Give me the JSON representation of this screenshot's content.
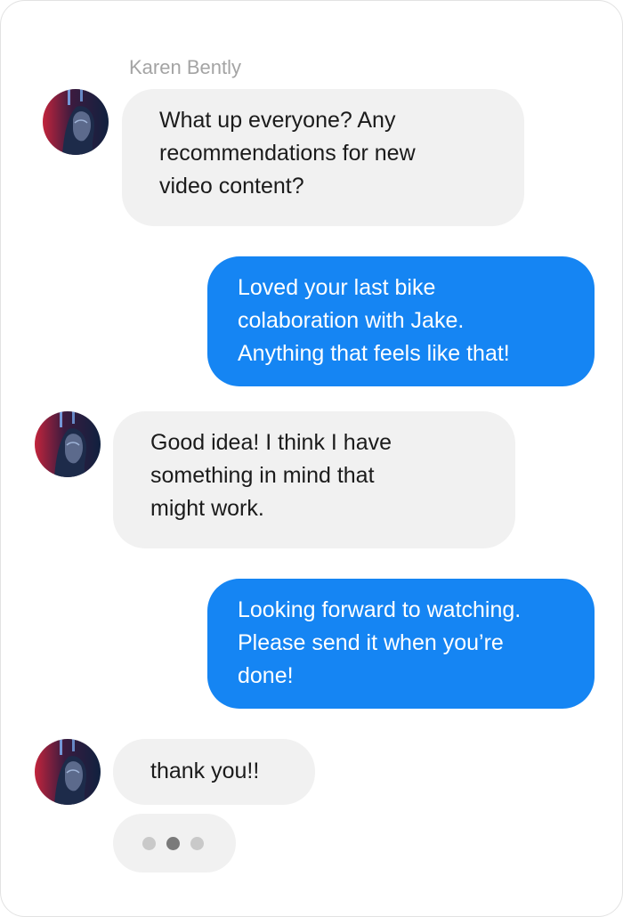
{
  "conversation": {
    "sender_name": "Karen Bently",
    "messages": [
      {
        "direction": "incoming",
        "lines": [
          "What up everyone? Any",
          "recommendations for new",
          "video content?"
        ]
      },
      {
        "direction": "outgoing",
        "lines": [
          "Loved your last bike",
          "colaboration with Jake.",
          "Anything that feels like that!"
        ]
      },
      {
        "direction": "incoming",
        "lines": [
          "Good idea! I think I have",
          "something in mind that",
          "might work."
        ]
      },
      {
        "direction": "outgoing",
        "lines": [
          "Looking forward to watching.",
          "Please send it when you’re",
          "done!"
        ]
      },
      {
        "direction": "incoming",
        "lines": [
          "thank you!!"
        ]
      }
    ],
    "typing_indicator": {
      "active_dot": 2,
      "dot_count": 3
    }
  },
  "colors": {
    "incoming_bubble": "#f1f1f1",
    "outgoing_bubble": "#1585f3",
    "sender_name": "#a4a4a4",
    "typing_dot_inactive": "#c9c9c9",
    "typing_dot_active": "#7a7a7a"
  },
  "icons": {
    "avatar": "avatar-portrait-icon"
  }
}
